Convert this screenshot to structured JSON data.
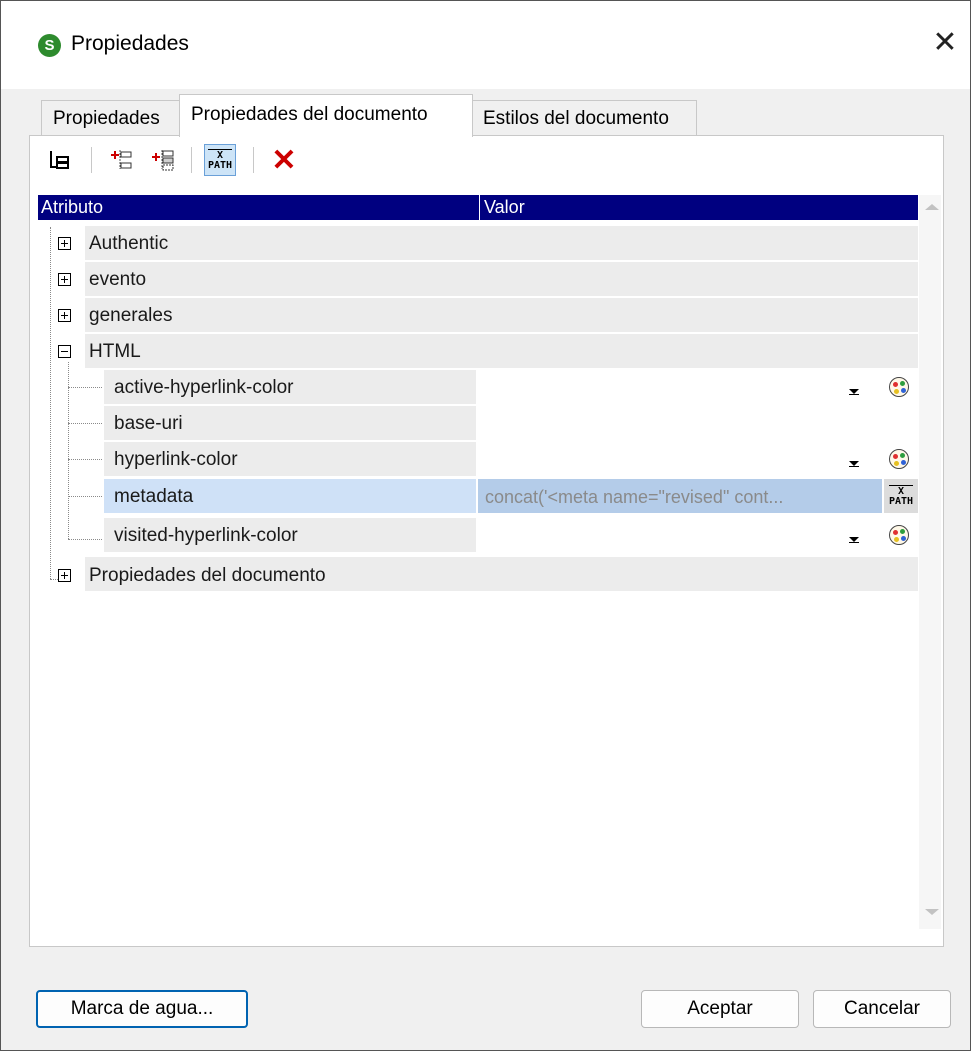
{
  "window": {
    "title": "Propiedades",
    "close_glyph": "✕",
    "app_icon_glyph": "S"
  },
  "tabs": [
    {
      "label": "Propiedades",
      "active": false
    },
    {
      "label": "Propiedades del documento",
      "active": true
    },
    {
      "label": "Estilos del documento",
      "active": false
    }
  ],
  "toolbar": {
    "icons": [
      "hierarchy-view-icon",
      "insert-property-icon",
      "append-property-icon",
      "xpath-toggle-icon",
      "delete-icon"
    ],
    "xpath_top": "X",
    "xpath_bottom": "PATH",
    "delete_glyph": "✕",
    "delete_color": "#cc0000"
  },
  "grid": {
    "col_attribute": "Atributo",
    "col_value": "Valor",
    "header_color": "#000080",
    "groups": {
      "authentic": {
        "label": "Authentic",
        "expanded": false
      },
      "evento": {
        "label": "evento",
        "expanded": false
      },
      "generales": {
        "label": "generales",
        "expanded": false
      },
      "html": {
        "label": "HTML",
        "expanded": true
      },
      "document": {
        "label": "Propiedades del documento",
        "expanded": false
      }
    },
    "html_children": {
      "active_hyperlink_color": {
        "label": "active-hyperlink-color",
        "value": ""
      },
      "base_uri": {
        "label": "base-uri",
        "value": ""
      },
      "hyperlink_color": {
        "label": "hyperlink-color",
        "value": ""
      },
      "metadata": {
        "label": "metadata",
        "value": "concat('<meta name=\"revised\" cont...",
        "selected": true
      },
      "visited_hyperlink_color": {
        "label": "visited-hyperlink-color",
        "value": ""
      }
    },
    "xpath_top": "X",
    "xpath_bottom": "PATH"
  },
  "buttons": {
    "watermark": "Marca de agua...",
    "ok": "Aceptar",
    "cancel": "Cancelar"
  }
}
